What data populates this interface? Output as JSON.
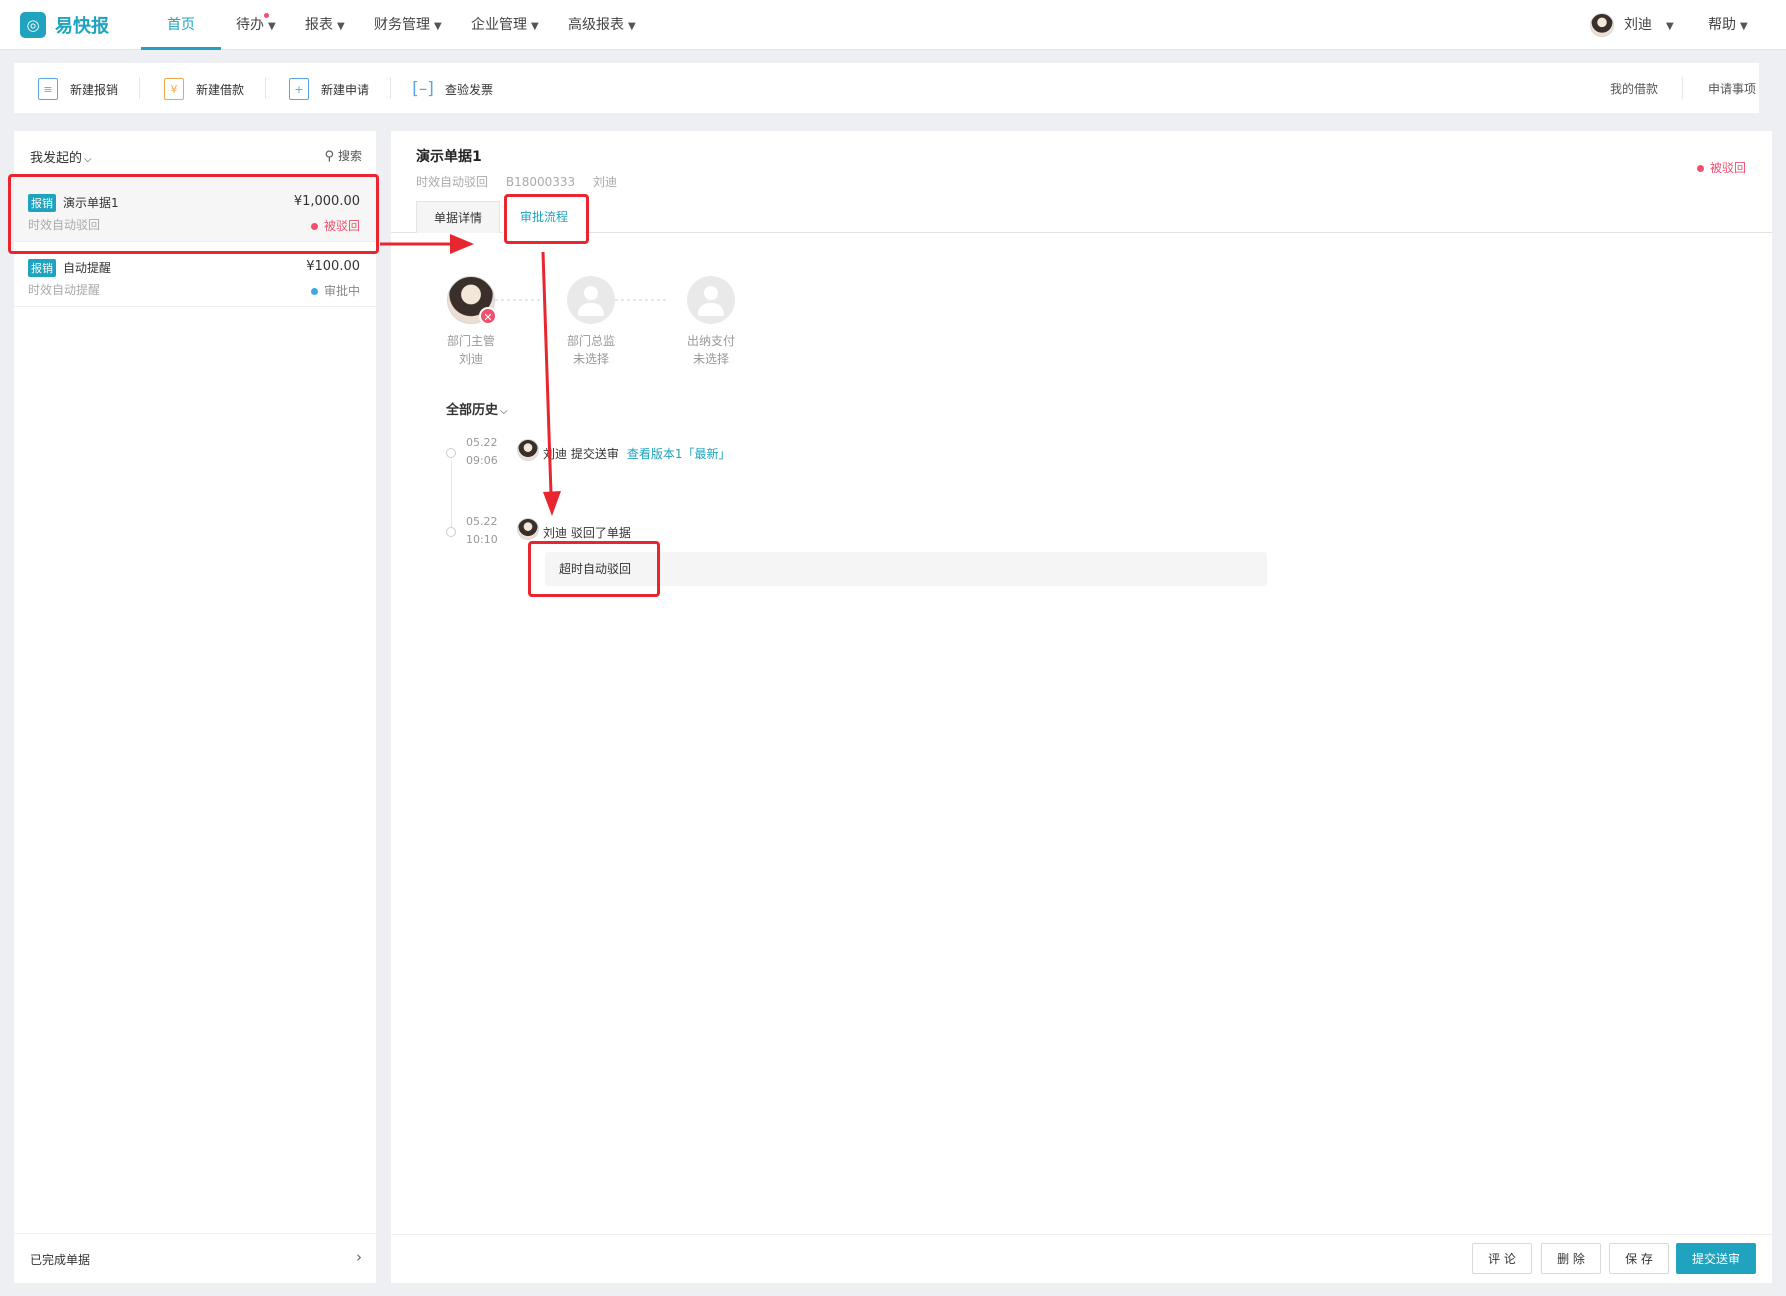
{
  "app": {
    "name": "易快报"
  },
  "nav": {
    "items": [
      "首页",
      "待办",
      "报表",
      "财务管理",
      "企业管理",
      "高级报表"
    ],
    "user": "刘迪",
    "help": "帮助"
  },
  "toolbar": {
    "actions": [
      "新建报销",
      "新建借款",
      "新建申请",
      "查验发票"
    ],
    "right": [
      "我的借款",
      "申请事项"
    ]
  },
  "sidebar": {
    "filter": "我发起的",
    "search": "搜索",
    "bills": [
      {
        "tag": "报销",
        "title": "演示单据1",
        "amount": "¥1,000.00",
        "sub": "时效自动驳回",
        "status": "被驳回",
        "status_color": "#f0506e"
      },
      {
        "tag": "报销",
        "title": "自动提醒",
        "amount": "¥100.00",
        "sub": "时效自动提醒",
        "status": "审批中",
        "status_color": "#3ea7e6"
      }
    ],
    "footer": "已完成单据"
  },
  "detail": {
    "title": "演示单据1",
    "meta": [
      "时效自动驳回",
      "B18000333",
      "刘迪"
    ],
    "status": "被驳回",
    "tabs": [
      "单据详情",
      "审批流程"
    ],
    "flow": [
      {
        "role": "部门主管",
        "person": "刘迪",
        "rejected": true
      },
      {
        "role": "部门总监",
        "person": "未选择",
        "rejected": false
      },
      {
        "role": "出纳支付",
        "person": "未选择",
        "rejected": false
      }
    ],
    "history_title": "全部历史",
    "history": [
      {
        "date": "05.22",
        "time": "09:06",
        "text": "刘迪 提交送审",
        "link": "查看版本1「最新」"
      },
      {
        "date": "05.22",
        "time": "10:10",
        "text": "刘迪 驳回了单据",
        "comment": "超时自动驳回"
      }
    ],
    "buttons": [
      "评 论",
      "删 除",
      "保 存",
      "提交送审"
    ]
  }
}
